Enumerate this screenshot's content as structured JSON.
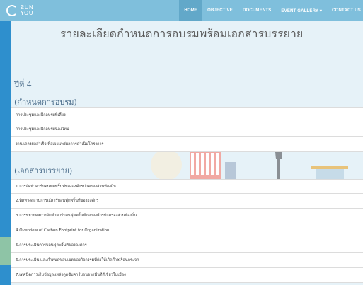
{
  "brand": {
    "line1": "ƧUN",
    "line2": "YOU"
  },
  "nav": {
    "items": [
      {
        "label": "HOME",
        "active": true
      },
      {
        "label": "OBJECTIVE",
        "active": false
      },
      {
        "label": "DOCUMENTS",
        "active": false
      },
      {
        "label": "EVENT GALLERY ▾",
        "active": false
      },
      {
        "label": "CONTACT US",
        "active": false
      }
    ]
  },
  "page": {
    "title": "รายละเอียดกำหนดการอบรมพร้อมเอกสารบรรยาย",
    "year_label": "ปีที่ 4"
  },
  "schedule": {
    "heading": "(กำหนดการอบรม)",
    "items": [
      "การประชุมและฝึกอบรมพี่เลี้ยง",
      "การประชุมและฝึกอบรมน้องใหม่",
      "งานแถลงผลสำเร็จเพื่อเผยแพร่ผลการดำเนินโครงการ"
    ]
  },
  "documents": {
    "heading": "(เอกสารบรรยาย)",
    "items": [
      "1.การจัดทำคาร์บอนฟุตพริ้นท์ขององค์กรปกครองส่วนท้องถิ่น",
      "2.ทิศทางสถานการณ์คาร์บอนฟุตพริ้นท์ขององค์กร",
      "3.การขยายผลการจัดทำคาร์บอนฟุตพริ้นท์ขององค์กรปกครองส่วนท้องถิ่น",
      "4.Overview of Carbon Footprint for Organization",
      "5.การประเมินคาร์บอนฟุตพริ้นท์ขององค์กร",
      "6.การประเมิน และกำหนดขอบเขตของกิจกรรมที่ก่อให้เกิดก๊าซเรือนกระจก",
      "7.เทคนิคการเก็บข้อมูลแหล่งดูดซับคาร์บอนจากพื้นที่สีเขียวในเมือง"
    ]
  },
  "colors": {
    "navbar": "#7fbfdc",
    "nav_active": "#62a8c9",
    "left_edge": "#2e8fcd",
    "section_heading": "#4a6c8a",
    "page_title": "#5c5c5c"
  }
}
